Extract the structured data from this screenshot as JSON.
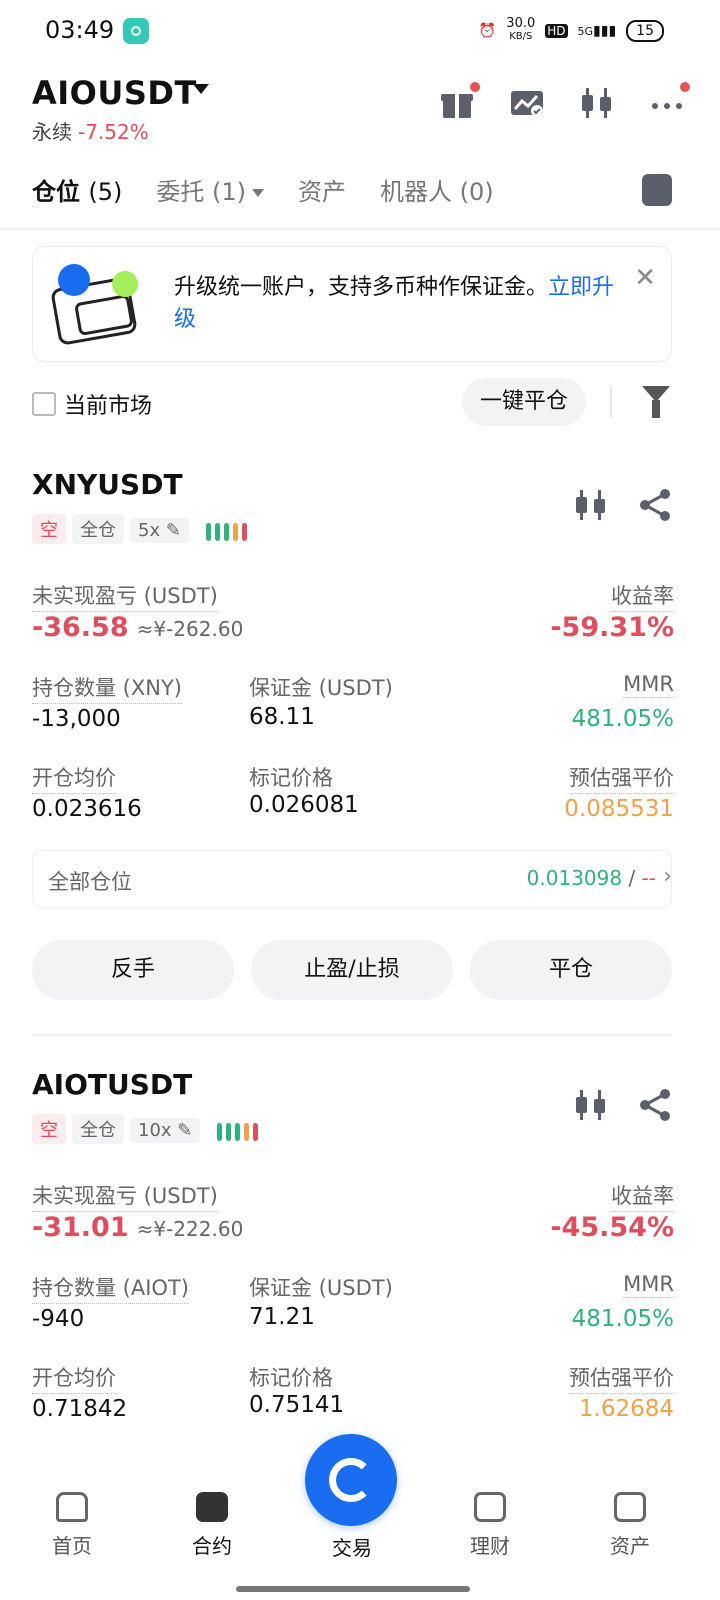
{
  "status_bar": {
    "time": "03:49",
    "net_speed": "30.0",
    "net_unit": "KB/S",
    "hd": "HD",
    "signal": "5G",
    "battery": "15"
  },
  "header": {
    "pair": "AIOUSDT",
    "type": "永续",
    "change": "-7.52%"
  },
  "tabs": [
    {
      "label": "仓位",
      "count": "(5)"
    },
    {
      "label": "委托",
      "count": "(1)"
    },
    {
      "label": "资产",
      "count": ""
    },
    {
      "label": "机器人",
      "count": "(0)"
    }
  ],
  "banner": {
    "text": "升级统一账户，支持多币种作保证金。",
    "link": "立即升级"
  },
  "filter": {
    "current_market": "当前市场",
    "close_all": "一键平仓"
  },
  "positions": [
    {
      "symbol": "XNYUSDT",
      "side": "空",
      "margin_mode": "全仓",
      "leverage": "5x",
      "unrealized_label": "未实现盈亏 (USDT)",
      "unrealized": "-36.58",
      "unrealized_cny": "≈¥-262.60",
      "roe_label": "收益率",
      "roe": "-59.31%",
      "qty_label": "持仓数量 (XNY)",
      "qty": "-13,000",
      "margin_label": "保证金 (USDT)",
      "margin": "68.11",
      "mmr_label": "MMR",
      "mmr": "481.05%",
      "entry_label": "开仓均价",
      "entry": "0.023616",
      "mark_label": "标记价格",
      "mark": "0.026081",
      "liq_label": "预估强平价",
      "liq": "0.085531",
      "all_label": "全部仓位",
      "all_value": "0.013098",
      "all_sep": " / ",
      "all_dash": "--",
      "btn_reverse": "反手",
      "btn_tpsl": "止盈/止损",
      "btn_close": "平仓"
    },
    {
      "symbol": "AIOTUSDT",
      "side": "空",
      "margin_mode": "全仓",
      "leverage": "10x",
      "unrealized_label": "未实现盈亏 (USDT)",
      "unrealized": "-31.01",
      "unrealized_cny": "≈¥-222.60",
      "roe_label": "收益率",
      "roe": "-45.54%",
      "qty_label": "持仓数量 (AIOT)",
      "qty": "-940",
      "margin_label": "保证金 (USDT)",
      "margin": "71.21",
      "mmr_label": "MMR",
      "mmr": "481.05%",
      "entry_label": "开仓均价",
      "entry": "0.71842",
      "mark_label": "标记价格",
      "mark": "0.75141",
      "liq_label": "预估强平价",
      "liq": "1.62684"
    }
  ],
  "bottom_nav": [
    {
      "label": "首页",
      "icon": "home-icon"
    },
    {
      "label": "合约",
      "icon": "futures-icon"
    },
    {
      "label": "交易",
      "icon": "trade-icon"
    },
    {
      "label": "理财",
      "icon": "earn-icon"
    },
    {
      "label": "资产",
      "icon": "wallet-icon"
    }
  ],
  "colors": {
    "red": "#e04d5e",
    "green": "#2fb27b",
    "orange": "#f0a24b",
    "blue": "#1a6cf0"
  }
}
